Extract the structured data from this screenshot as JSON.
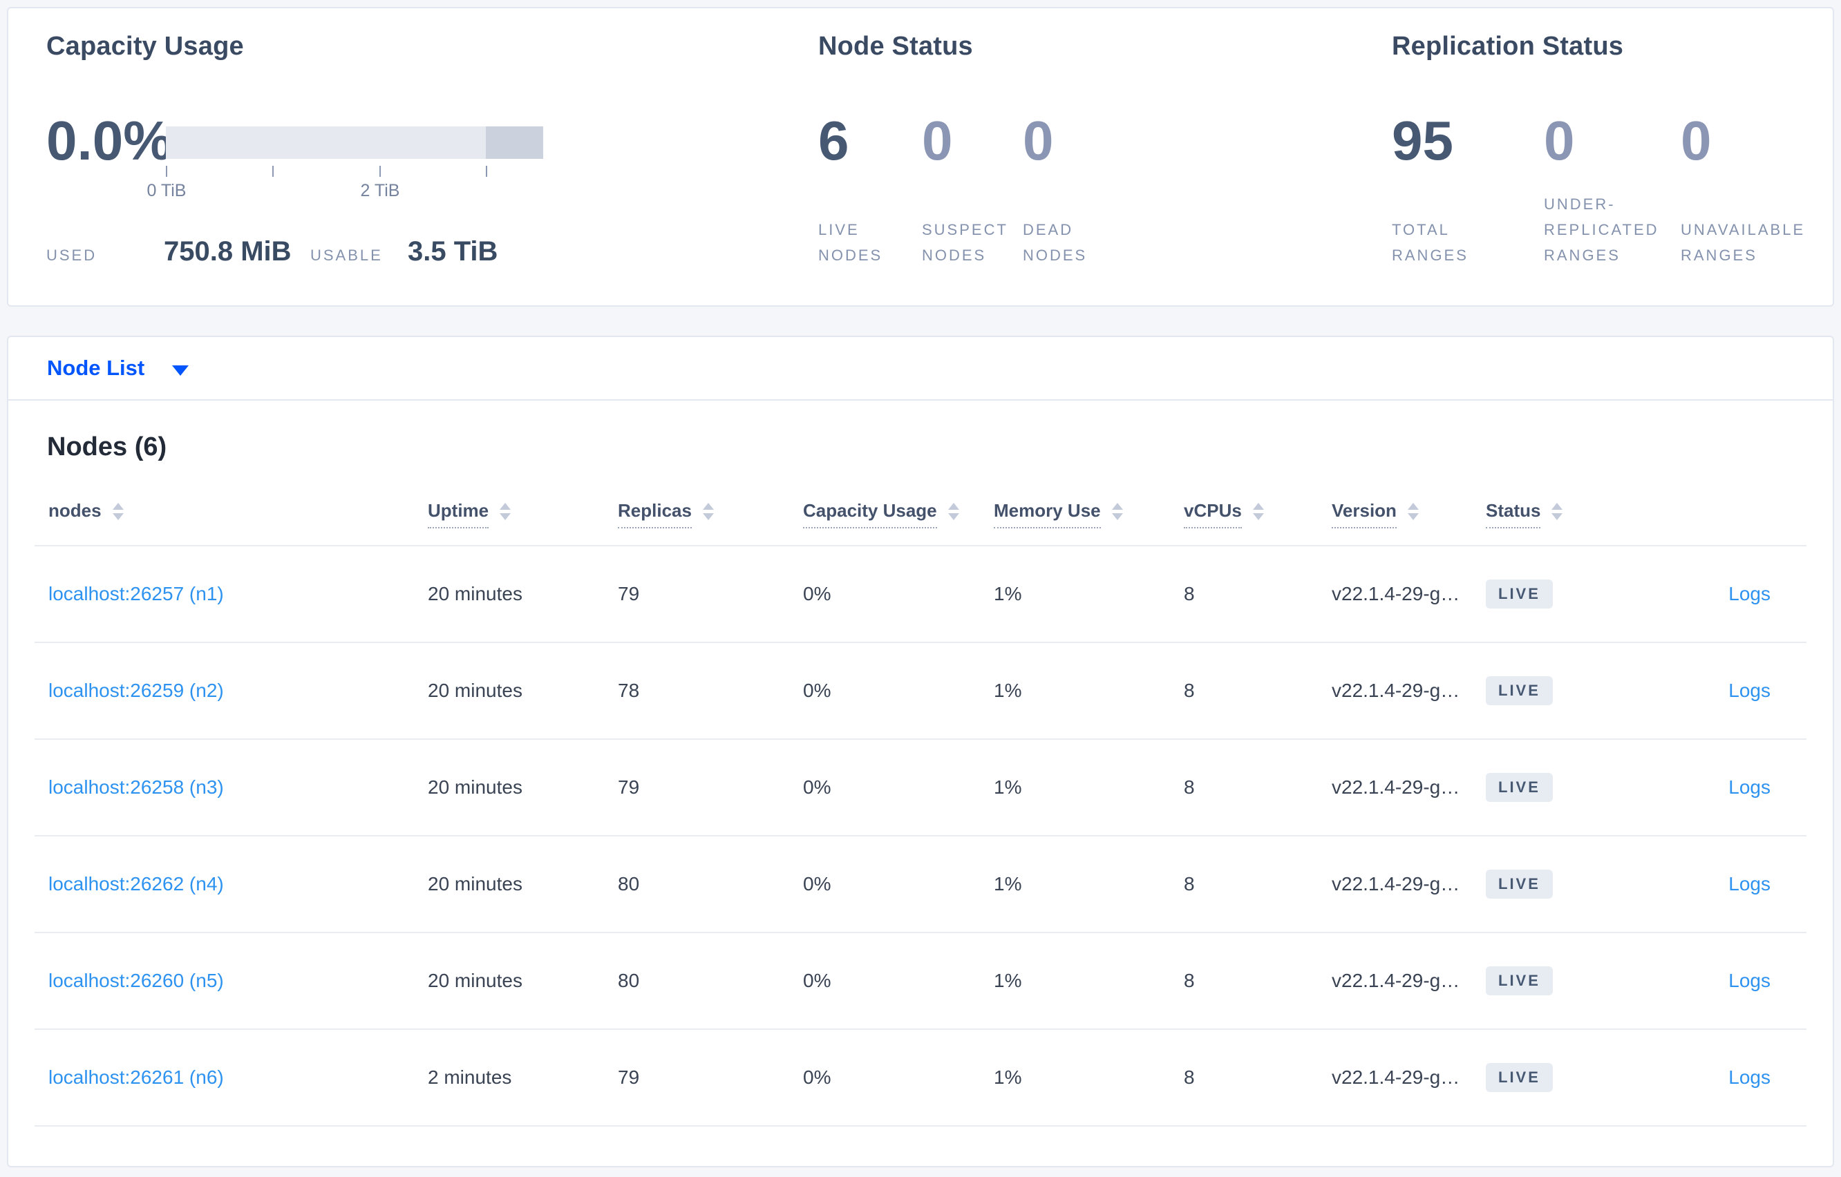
{
  "colors": {
    "page_background": "#f4f6fa",
    "card_background": "#ffffff",
    "card_border": "#e2e7f0",
    "title_text": "#3b4a63",
    "primary_stat": "#475872",
    "muted_stat": "#8b96b4",
    "muted_label": "#8492ad",
    "selector_link_blue": "#0055ff",
    "table_link_blue": "#2d92f0",
    "badge_background": "#e7ecf3",
    "capacity_bar_light": "#e7e9f1",
    "capacity_bar_dark": "#ccd1de"
  },
  "summary": {
    "capacity": {
      "title": "Capacity Usage",
      "percent": "0.0%",
      "tick_label_0": "0 TiB",
      "tick_label_2": "2 TiB",
      "used_label": "USED",
      "used_value": "750.8 MiB",
      "usable_label": "USABLE",
      "usable_value": "3.5 TiB"
    },
    "node_status": {
      "title": "Node Status",
      "stats": [
        {
          "value": "6",
          "label": "LIVE\nNODES"
        },
        {
          "value": "0",
          "label": "SUSPECT\nNODES"
        },
        {
          "value": "0",
          "label": "DEAD\nNODES"
        }
      ]
    },
    "replication": {
      "title": "Replication Status",
      "stats": [
        {
          "value": "95",
          "label": "TOTAL\nRANGES"
        },
        {
          "value": "0",
          "label": "UNDER-\nREPLICATED\nRANGES"
        },
        {
          "value": "0",
          "label": "UNAVAILABLE\nRANGES"
        }
      ]
    }
  },
  "selector": {
    "label": "Node List"
  },
  "nodes": {
    "heading": "Nodes (6)",
    "columns": {
      "nodes": "nodes",
      "uptime": "Uptime",
      "replicas": "Replicas",
      "capacity": "Capacity Usage",
      "memory": "Memory Use",
      "vcpus": "vCPUs",
      "version": "Version",
      "status": "Status"
    },
    "rows": [
      {
        "node": "localhost:26257 (n1)",
        "uptime": "20 minutes",
        "replicas": "79",
        "capacity_usage": "0%",
        "memory_use": "1%",
        "vcpus": "8",
        "version": "v22.1.4-29-g…",
        "status": "LIVE",
        "logs": "Logs"
      },
      {
        "node": "localhost:26259 (n2)",
        "uptime": "20 minutes",
        "replicas": "78",
        "capacity_usage": "0%",
        "memory_use": "1%",
        "vcpus": "8",
        "version": "v22.1.4-29-g…",
        "status": "LIVE",
        "logs": "Logs"
      },
      {
        "node": "localhost:26258 (n3)",
        "uptime": "20 minutes",
        "replicas": "79",
        "capacity_usage": "0%",
        "memory_use": "1%",
        "vcpus": "8",
        "version": "v22.1.4-29-g…",
        "status": "LIVE",
        "logs": "Logs"
      },
      {
        "node": "localhost:26262 (n4)",
        "uptime": "20 minutes",
        "replicas": "80",
        "capacity_usage": "0%",
        "memory_use": "1%",
        "vcpus": "8",
        "version": "v22.1.4-29-g…",
        "status": "LIVE",
        "logs": "Logs"
      },
      {
        "node": "localhost:26260 (n5)",
        "uptime": "20 minutes",
        "replicas": "80",
        "capacity_usage": "0%",
        "memory_use": "1%",
        "vcpus": "8",
        "version": "v22.1.4-29-g…",
        "status": "LIVE",
        "logs": "Logs"
      },
      {
        "node": "localhost:26261 (n6)",
        "uptime": "2 minutes",
        "replicas": "79",
        "capacity_usage": "0%",
        "memory_use": "1%",
        "vcpus": "8",
        "version": "v22.1.4-29-g…",
        "status": "LIVE",
        "logs": "Logs"
      }
    ]
  }
}
